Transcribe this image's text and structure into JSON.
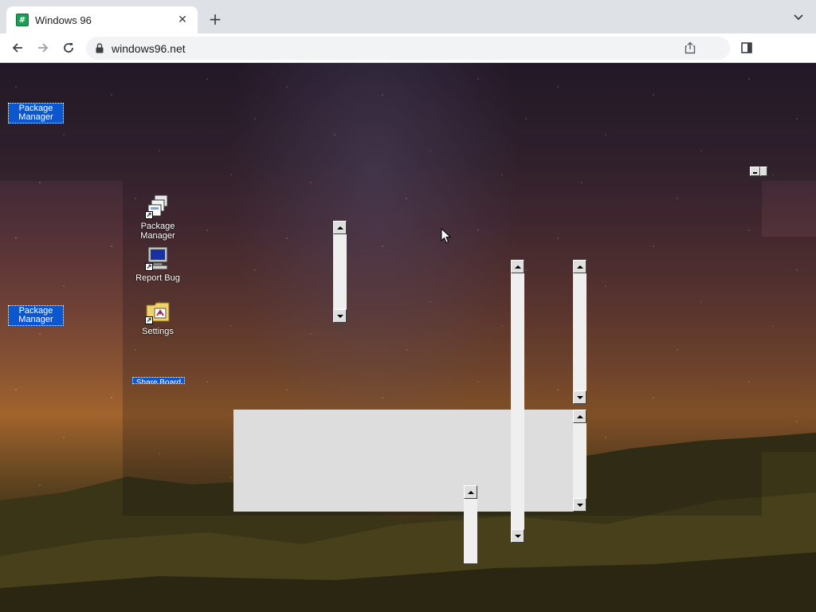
{
  "browser": {
    "tab": {
      "title": "Windows 96",
      "favicon": "windows96-grid-icon"
    },
    "url": "windows96.net",
    "buttons": [
      "back",
      "forward",
      "reload",
      "share",
      "side-panel",
      "new-tab",
      "tab-search"
    ]
  },
  "desktop": {
    "labels": {
      "package_manager_top": "Package Manager",
      "package_manager_mid": "Package Manager"
    },
    "icons": [
      {
        "label": "Package Manager",
        "icon": "package-manager-icon"
      },
      {
        "label": "Report Bug",
        "icon": "monitor-icon"
      },
      {
        "label": "Settings",
        "icon": "settings-folder-icon"
      }
    ],
    "share_board": "Share Board"
  },
  "colors": {
    "selection_blue": "#0b57d0",
    "scrollbar_track": "#efefef",
    "panel_grey": "#dddddd"
  }
}
